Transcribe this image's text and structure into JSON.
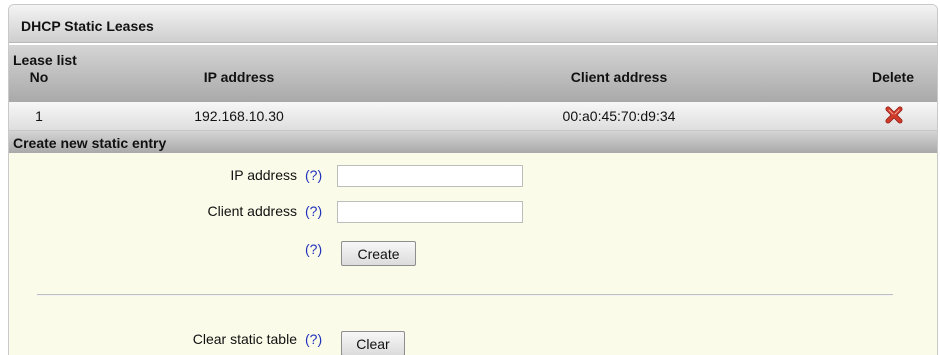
{
  "panel": {
    "title": "DHCP Static Leases"
  },
  "lease_list": {
    "section_title": "Lease list",
    "columns": [
      "No",
      "IP address",
      "Client address",
      "Delete"
    ],
    "rows": [
      {
        "no": "1",
        "ip": "192.168.10.30",
        "client": "00:a0:45:70:d9:34",
        "delete_icon": "red-x-icon"
      }
    ]
  },
  "create": {
    "section_title": "Create new static entry",
    "ip_label": "IP address",
    "client_label": "Client address",
    "help": "(?)",
    "ip_value": "",
    "client_value": "",
    "create_button": "Create"
  },
  "clear": {
    "label": "Clear static table",
    "help": "(?)",
    "button": "Clear"
  },
  "colors": {
    "background": "#fbfbe9",
    "help_link": "#2233bb",
    "delete_icon": "#d03a2a"
  }
}
